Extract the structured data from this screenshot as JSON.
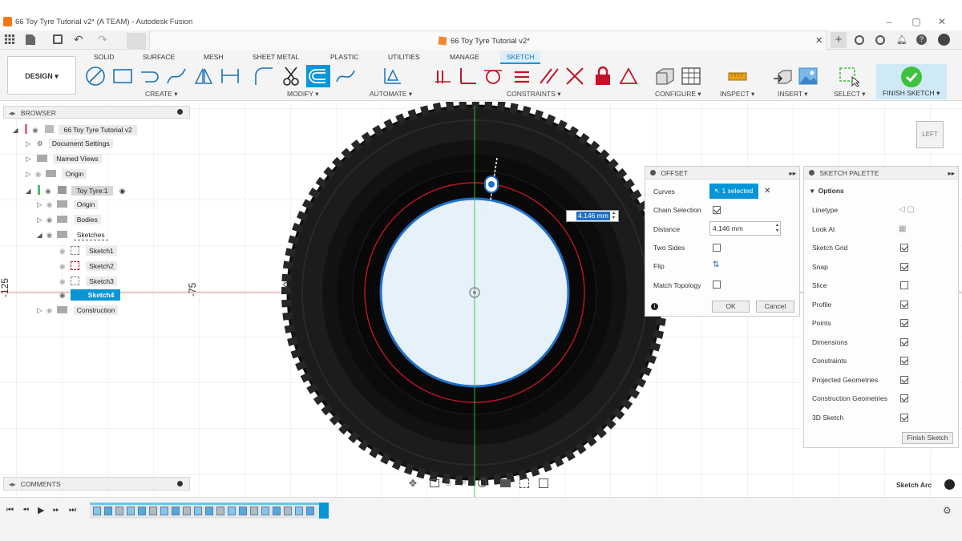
{
  "window": {
    "title": "66 Toy Tyre Tutorial v2* (A TEAM) - Autodesk Fusion"
  },
  "document_tab": {
    "title": "66 Toy Tyre Tutorial v2*"
  },
  "toolbar": {
    "workspace": "DESIGN",
    "tabs": [
      "SOLID",
      "SURFACE",
      "MESH",
      "SHEET METAL",
      "PLASTIC",
      "UTILITIES",
      "MANAGE",
      "SKETCH"
    ],
    "active_tab": "SKETCH",
    "groups": [
      "CREATE",
      "MODIFY",
      "AUTOMATE",
      "CONSTRAINTS",
      "CONFIGURE",
      "INSPECT",
      "INSERT",
      "SELECT",
      "FINISH SKETCH"
    ]
  },
  "browser": {
    "title": "BROWSER",
    "items": [
      {
        "label": "66 Toy Tyre Tutorial v2"
      },
      {
        "label": "Document Settings"
      },
      {
        "label": "Named Views"
      },
      {
        "label": "Origin"
      },
      {
        "label": "Toy Tyre:1"
      },
      {
        "label": "Origin"
      },
      {
        "label": "Bodies"
      },
      {
        "label": "Sketches"
      },
      {
        "label": "Sketch1"
      },
      {
        "label": "Sketch2"
      },
      {
        "label": "Sketch3"
      },
      {
        "label": "Sketch4"
      },
      {
        "label": "Construction"
      }
    ]
  },
  "comments": {
    "title": "COMMENTS"
  },
  "axis_labels": [
    "-125",
    "-75",
    "-50"
  ],
  "viewcube": {
    "face": "LEFT"
  },
  "dimension_input": {
    "value": "4.146 mm"
  },
  "offset": {
    "title": "OFFSET",
    "curves_label": "Curves",
    "curves_value": "1 selected",
    "chain_label": "Chain Selection",
    "distance_label": "Distance",
    "distance_value": "4.146 mm",
    "two_sides_label": "Two Sides",
    "flip_label": "Flip",
    "match_label": "Match Topology",
    "ok": "OK",
    "cancel": "Cancel"
  },
  "palette": {
    "title": "SKETCH PALETTE",
    "section": "Options",
    "rows": [
      {
        "label": "Linetype"
      },
      {
        "label": "Look At"
      },
      {
        "label": "Sketch Grid",
        "checked": true
      },
      {
        "label": "Snap",
        "checked": true
      },
      {
        "label": "Slice",
        "checked": false
      },
      {
        "label": "Profile",
        "checked": true
      },
      {
        "label": "Points",
        "checked": true
      },
      {
        "label": "Dimensions",
        "checked": true
      },
      {
        "label": "Constraints",
        "checked": true
      },
      {
        "label": "Projected Geometries",
        "checked": true
      },
      {
        "label": "Construction Geometries",
        "checked": true
      },
      {
        "label": "3D Sketch",
        "checked": true
      }
    ],
    "finish": "Finish Sketch"
  },
  "status": {
    "text": "Sketch Arc"
  },
  "colors": {
    "accent": "#0696d7",
    "finish_green": "#3cc23c",
    "profile_fill": "#e6f1fa",
    "red_circle": "#c0142a"
  }
}
